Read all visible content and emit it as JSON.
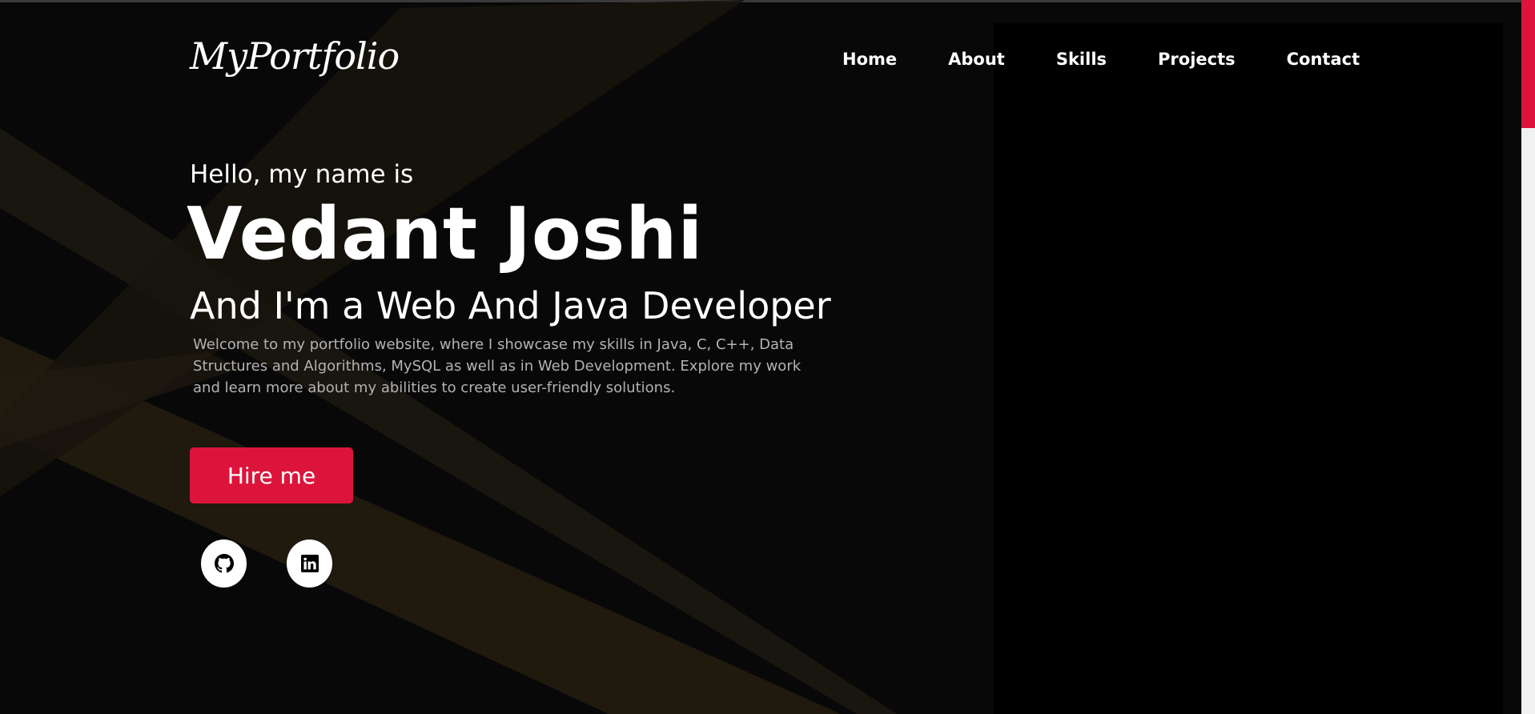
{
  "logo": {
    "text": "MyPortfolio"
  },
  "nav": {
    "items": [
      {
        "label": "Home"
      },
      {
        "label": "About"
      },
      {
        "label": "Skills"
      },
      {
        "label": "Projects"
      },
      {
        "label": "Contact"
      }
    ]
  },
  "hero": {
    "greeting": "Hello, my name is",
    "name": "Vedant Joshi",
    "role": "And I'm a Web And Java Developer",
    "description": "Welcome to my portfolio website, where I showcase my skills in Java, C, C++, Data Structures and Algorithms, MySQL as well as in Web Development. Explore my work and learn more about my abilities to create user-friendly solutions.",
    "cta_label": "Hire me"
  },
  "social": [
    {
      "icon": "github-icon"
    },
    {
      "icon": "linkedin-icon"
    }
  ],
  "colors": {
    "accent": "#dc143c",
    "background": "#080808",
    "ray": "#2a2312",
    "text": "#ffffff",
    "muted_text": "#b3b3b3"
  }
}
